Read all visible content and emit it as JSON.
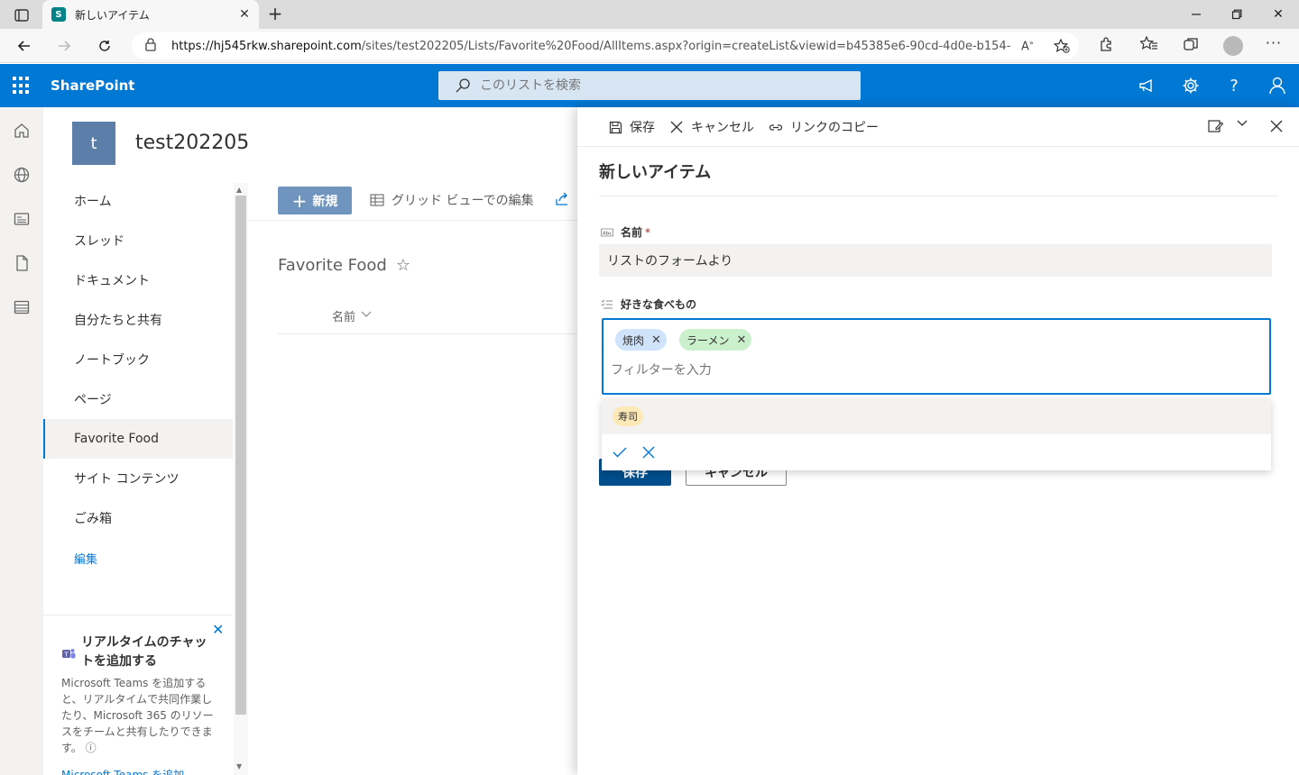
{
  "browser": {
    "tab_title": "新しいアイテム",
    "tab_favicon_letter": "S",
    "url_host": "https://hj545rkw.sharepoint.com",
    "url_path": "/sites/test202205/Lists/Favorite%20Food/AllItems.aspx?origin=createList&viewid=b45385e6-90cd-4d0e-b154-5cc0e..."
  },
  "suite": {
    "brand": "SharePoint",
    "search_placeholder": "このリストを検索",
    "accent_color": "#0078d4"
  },
  "site": {
    "logo_letter": "t",
    "name": "test202205"
  },
  "sitenav": {
    "items": [
      {
        "label": "ホーム"
      },
      {
        "label": "スレッド"
      },
      {
        "label": "ドキュメント"
      },
      {
        "label": "自分たちと共有"
      },
      {
        "label": "ノートブック"
      },
      {
        "label": "ページ"
      },
      {
        "label": "Favorite Food"
      },
      {
        "label": "サイト コンテンツ"
      },
      {
        "label": "ごみ箱"
      }
    ],
    "active_item": "Favorite Food",
    "edit_label": "編集"
  },
  "teams_card": {
    "title": "リアルタイムのチャットを追加する",
    "body": "Microsoft Teams を追加すると、リアルタイムで共同作業したり、Microsoft 365 のリソースをチームと共有したりできます。",
    "info_icon": "ⓘ",
    "link": "Microsoft Teams を追加"
  },
  "commandbar": {
    "new_label": "新規",
    "grid_edit_label": "グリッド ビューでの編集"
  },
  "list": {
    "title": "Favorite Food",
    "column_name": "名前"
  },
  "panel": {
    "save_label": "保存",
    "cancel_label": "キャンセル",
    "copy_link_label": "リンクのコピー",
    "title": "新しいアイテム",
    "name_field": {
      "label": "名前",
      "required_mark": "*",
      "value": "リストのフォームより"
    },
    "food_field": {
      "label": "好きな食べもの",
      "selected": [
        {
          "label": "焼肉",
          "color": "#cfe4fa"
        },
        {
          "label": "ラーメン",
          "color": "#caf0cc"
        }
      ],
      "filter_placeholder": "フィルターを入力",
      "options": [
        {
          "label": "寿司",
          "color": "#fde8b8"
        }
      ]
    },
    "form_save_label": "保存",
    "form_cancel_label": "キャンセル"
  }
}
